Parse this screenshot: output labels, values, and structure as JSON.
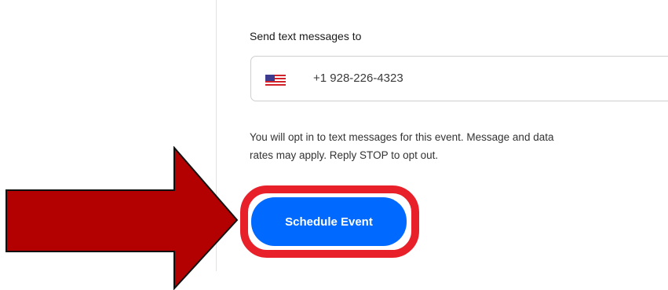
{
  "sms": {
    "label": "Send text messages to",
    "country_flag_icon": "us-flag-icon",
    "phone_value": "+1 928-226-4323",
    "disclaimer_line1": "You will opt in to text messages for this event. Message and data",
    "disclaimer_line2": "rates may apply. Reply STOP to opt out."
  },
  "actions": {
    "schedule_label": "Schedule Event"
  },
  "annotations": {
    "arrow_icon": "arrow-right-icon",
    "arrow_color": "#b30000",
    "ring_color": "#e8202a",
    "button_color": "#0069ff"
  }
}
